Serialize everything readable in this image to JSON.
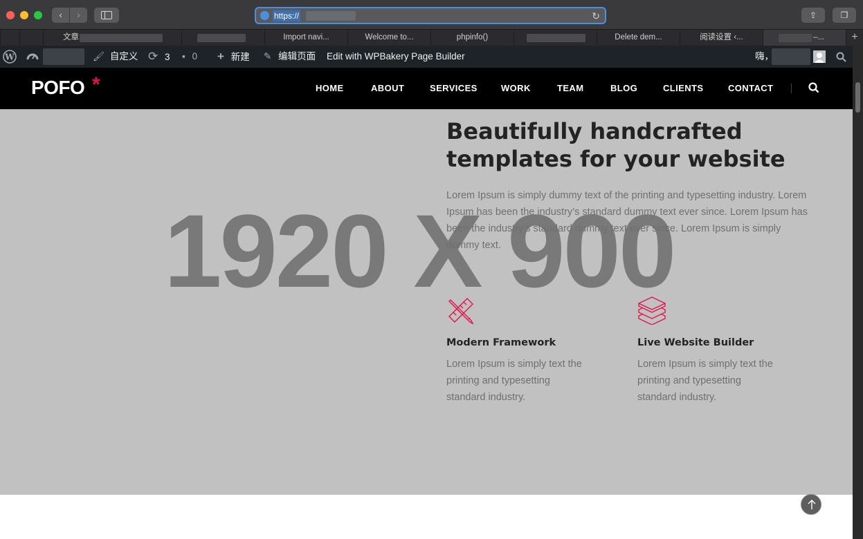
{
  "browser": {
    "url": "https://",
    "tabs": [
      "文章",
      "",
      "Import navi...",
      "Welcome to...",
      "phpinfo()",
      "",
      "Delete dem...",
      "阅读设置 ‹...",
      "–..."
    ],
    "new_tab_icon": "plus-icon"
  },
  "adminbar": {
    "customize": "自定义",
    "updates_count": "3",
    "comments_count": "0",
    "new": "新建",
    "edit_page": "编辑页面",
    "wpbakery": "Edit with WPBakery Page Builder",
    "greeting": "嗨，"
  },
  "site": {
    "logo": "POFO",
    "logo_star": "*",
    "menu": [
      "HOME",
      "ABOUT",
      "SERVICES",
      "WORK",
      "TEAM",
      "BLOG",
      "CLIENTS",
      "CONTACT"
    ]
  },
  "content": {
    "placeholder": "1920 X 900",
    "headline_line1": "Beautifully handcrafted",
    "headline_line2": "templates for your website",
    "intro": "Lorem Ipsum is simply dummy text of the printing and typesetting industry. Lorem Ipsum has been the industry’s standard dummy text ever since. Lorem Ipsum has been the industry’s standard dummy text ever since. Lorem Ipsum is simply dummy text.",
    "features": [
      {
        "title": "Modern Framework",
        "text": "Lorem Ipsum is simply text the printing and typesetting standard industry.",
        "icon": "pencil-ruler-icon"
      },
      {
        "title": "Live Website Builder",
        "text": "Lorem Ipsum is simply text the printing and typesetting standard industry.",
        "icon": "layers-icon"
      }
    ]
  },
  "colors": {
    "accent": "#e3124d",
    "content_bg": "#c1c1c1",
    "header_bg": "#000000",
    "adminbar_bg": "#1d2327"
  }
}
